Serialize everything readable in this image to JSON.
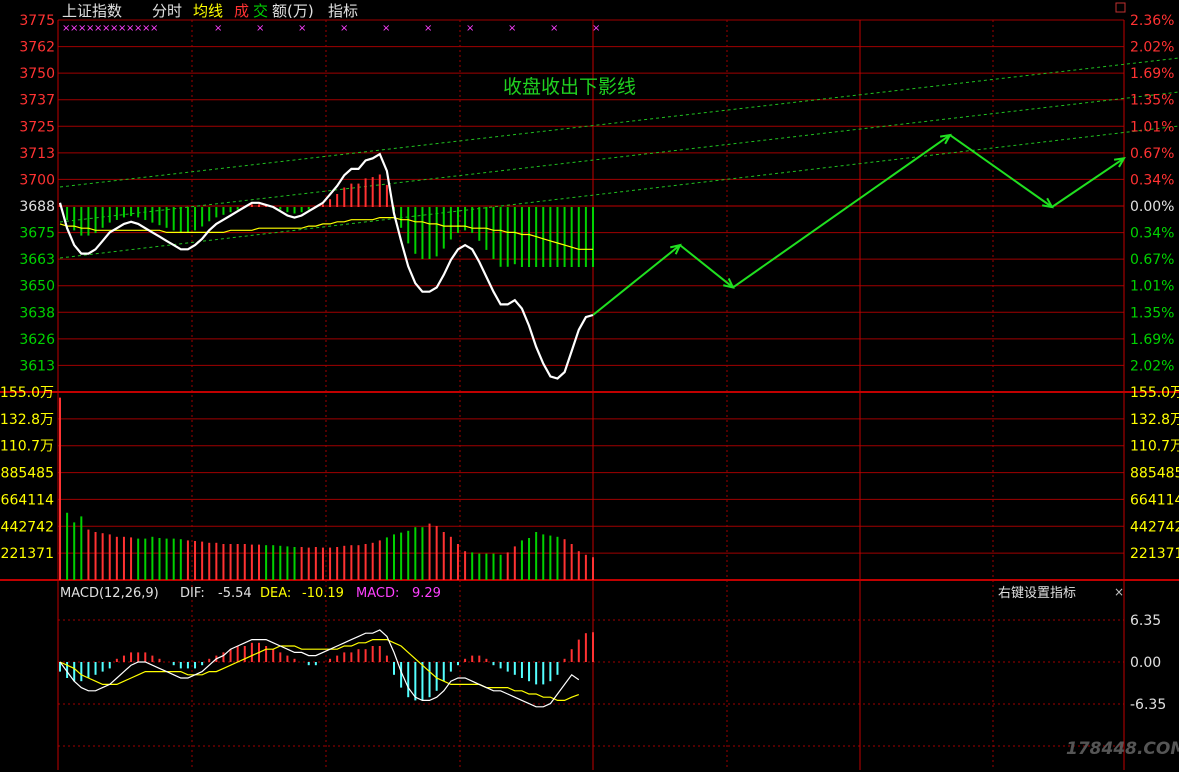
{
  "header": {
    "index_name": "上证指数",
    "timeframe": "分时",
    "avg_label": "均线",
    "cheng_label": "成",
    "jiao_label": "交",
    "amount_label": "额(万)",
    "indicator_label": "指标"
  },
  "annotation": {
    "text": "收盘收出下影线"
  },
  "macd_header": {
    "name": "MACD(12,26,9)",
    "dif_label": "DIF:",
    "dif_value": "-5.54",
    "dea_label": "DEA:",
    "dea_value": "-10.19",
    "macd_label": "MACD:",
    "macd_value": "9.29",
    "right_menu": "右键设置指标"
  },
  "watermark": "178448.COM",
  "colors": {
    "up": "#ff3232",
    "down": "#00d200",
    "grid": "#a00000",
    "price_line": "#ffffff",
    "avg_line": "#ffff00",
    "arrow": "#20e020",
    "channel": "#20c020",
    "macd_neg_bar": "#54ffff",
    "magenta": "#ff40ff"
  },
  "chart_data": [
    {
      "type": "line",
      "title": "上证指数 分时",
      "y_ticks_left": [
        "3775",
        "3762",
        "3750",
        "3737",
        "3725",
        "3713",
        "3700",
        "3688",
        "3675",
        "3663",
        "3650",
        "3638",
        "3626",
        "3613"
      ],
      "y_ticks_right": [
        "2.36%",
        "2.02%",
        "1.69%",
        "1.35%",
        "1.01%",
        "0.67%",
        "0.34%",
        "0.00%",
        "0.34%",
        "0.67%",
        "1.01%",
        "1.35%",
        "1.69%",
        "2.02%"
      ],
      "ylim": [
        3600,
        3775
      ],
      "prev_close": 3688,
      "series": [
        {
          "values": [
            3690,
            3678,
            3670,
            3666,
            3666,
            3668,
            3672,
            3676,
            3678,
            3680,
            3681,
            3680,
            3678,
            3676,
            3674,
            3672,
            3670,
            3668,
            3668,
            3670,
            3673,
            3677,
            3680,
            3682,
            3684,
            3686,
            3688,
            3690,
            3690,
            3689,
            3688,
            3686,
            3684,
            3683,
            3684,
            3686,
            3688,
            3690,
            3694,
            3698,
            3703,
            3706,
            3706,
            3710,
            3711,
            3713,
            3705,
            3685,
            3672,
            3660,
            3652,
            3648,
            3648,
            3650,
            3656,
            3663,
            3668,
            3670,
            3668,
            3662,
            3655,
            3648,
            3642,
            3642,
            3644,
            3640,
            3632,
            3622,
            3614,
            3608,
            3607,
            3610,
            3620,
            3630,
            3636,
            3637
          ]
        },
        {
          "values": [
            3680,
            3679,
            3679,
            3678,
            3678,
            3677,
            3677,
            3677,
            3677,
            3677,
            3677,
            3677,
            3677,
            3677,
            3677,
            3676,
            3676,
            3676,
            3676,
            3676,
            3676,
            3676,
            3676,
            3676,
            3677,
            3677,
            3677,
            3677,
            3678,
            3678,
            3678,
            3678,
            3678,
            3678,
            3678,
            3679,
            3679,
            3680,
            3680,
            3681,
            3681,
            3682,
            3682,
            3682,
            3682,
            3683,
            3683,
            3683,
            3682,
            3682,
            3681,
            3681,
            3680,
            3680,
            3679,
            3679,
            3679,
            3679,
            3678,
            3678,
            3678,
            3677,
            3677,
            3676,
            3676,
            3675,
            3675,
            3674,
            3673,
            3672,
            3671,
            3670,
            3669,
            3668,
            3668,
            3668
          ]
        }
      ],
      "projection": {
        "points": [
          [
            "13:25",
            3637
          ],
          [
            "14:00",
            3670
          ],
          [
            "14:30",
            3650
          ],
          [
            "16:30",
            3722
          ],
          [
            "17:30",
            3688
          ],
          [
            "18:00",
            3711
          ]
        ]
      },
      "marker_counts": {
        "dense": 12,
        "sparse": 10
      },
      "volume": {
        "y_ticks_left": [
          "155.0万",
          "132.8万",
          "110.7万",
          "885485",
          "664114",
          "442742",
          "221371"
        ],
        "y_ticks_right": [
          "155.0万",
          "132.8万",
          "110.7万",
          "885485",
          "664114",
          "442742",
          "221371"
        ],
        "ylim": [
          0,
          1550000
        ],
        "bars": [
          1520000,
          560000,
          480000,
          530000,
          420000,
          400000,
          390000,
          380000,
          360000,
          360000,
          355000,
          345000,
          345000,
          360000,
          350000,
          345000,
          345000,
          340000,
          330000,
          325000,
          320000,
          310000,
          310000,
          300000,
          300000,
          300000,
          300000,
          295000,
          295000,
          290000,
          290000,
          285000,
          280000,
          275000,
          275000,
          270000,
          275000,
          270000,
          270000,
          275000,
          285000,
          290000,
          290000,
          300000,
          310000,
          330000,
          355000,
          380000,
          395000,
          410000,
          440000,
          440000,
          470000,
          450000,
          400000,
          360000,
          300000,
          240000,
          230000,
          220000,
          220000,
          220000,
          210000,
          230000,
          280000,
          330000,
          350000,
          400000,
          380000,
          370000,
          360000,
          340000,
          300000,
          240000,
          210000,
          190000
        ]
      }
    },
    {
      "type": "bar",
      "title": "MACD(12,26,9)",
      "y_ticks": [
        "6.35",
        "0.00",
        "-6.35"
      ],
      "ylim": [
        -14,
        13
      ],
      "macd": [
        -3,
        -5,
        -6,
        -6,
        -5,
        -4,
        -3,
        -2,
        1,
        2,
        3,
        3,
        3,
        2,
        1,
        0,
        -1,
        -2,
        -2,
        -2,
        -1,
        1,
        2,
        3,
        4,
        5,
        5,
        6,
        6,
        5,
        4,
        3,
        2,
        1,
        0,
        -1,
        -1,
        0,
        1,
        2,
        3,
        3,
        4,
        4,
        5,
        5,
        2,
        -4,
        -8,
        -11,
        -12,
        -12,
        -11,
        -9,
        -6,
        -3,
        -1,
        1,
        2,
        2,
        1,
        -1,
        -2,
        -3,
        -4,
        -5,
        -6,
        -7,
        -7,
        -6,
        -4,
        1,
        4,
        7,
        9,
        9.3
      ],
      "dif": [
        0,
        -3,
        -6,
        -8,
        -9,
        -9,
        -8,
        -7,
        -5,
        -3,
        -1,
        0,
        0,
        -1,
        -2,
        -3,
        -4,
        -5,
        -5,
        -4,
        -3,
        -1,
        1,
        2,
        4,
        5,
        6,
        7,
        7,
        7,
        6,
        5,
        4,
        3,
        3,
        2,
        2,
        3,
        4,
        5,
        6,
        7,
        8,
        9,
        9,
        10,
        8,
        3,
        -3,
        -8,
        -11,
        -12,
        -12,
        -11,
        -9,
        -6,
        -5,
        -5,
        -6,
        -7,
        -8,
        -9,
        -9,
        -10,
        -11,
        -12,
        -13,
        -14,
        -14,
        -13,
        -10,
        -7,
        -4,
        -5.54
      ],
      "dea": [
        0,
        -1,
        -2,
        -4,
        -5,
        -6,
        -7,
        -7,
        -7,
        -6,
        -5,
        -4,
        -3,
        -3,
        -3,
        -3,
        -3,
        -3,
        -4,
        -4,
        -4,
        -3,
        -3,
        -2,
        -1,
        0,
        1,
        2,
        3,
        4,
        4,
        5,
        5,
        5,
        4,
        4,
        4,
        4,
        4,
        4,
        5,
        5,
        6,
        6,
        7,
        7,
        7,
        6,
        5,
        3,
        1,
        -1,
        -3,
        -5,
        -6,
        -7,
        -7,
        -7,
        -7,
        -7,
        -8,
        -8,
        -8,
        -8,
        -9,
        -9,
        -10,
        -10,
        -11,
        -11,
        -12,
        -12,
        -11,
        -10.19
      ]
    }
  ]
}
